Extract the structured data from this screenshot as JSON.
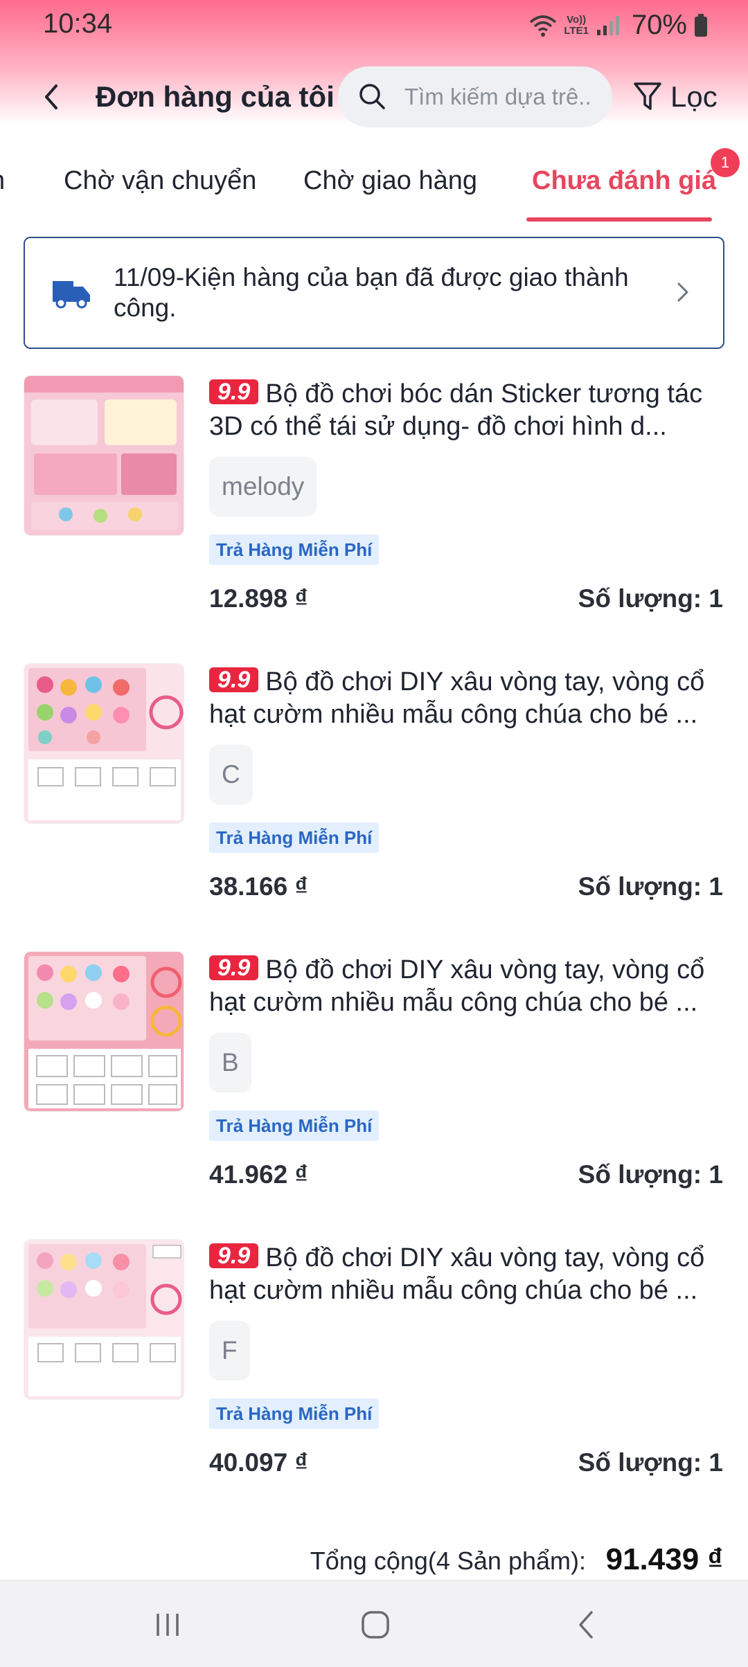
{
  "status_bar": {
    "time": "10:34",
    "network_line1": "Vo))",
    "network_line2": "LTE1",
    "battery": "70%"
  },
  "header": {
    "title": "Đơn hàng của tôi",
    "search_placeholder": "Tìm kiếm dựa trê...",
    "filter_label": "Lọc",
    "accent": "#e8455e"
  },
  "tabs": {
    "items": [
      {
        "label": "n"
      },
      {
        "label": "Chờ vận chuyển"
      },
      {
        "label": "Chờ giao hàng"
      },
      {
        "label": "Chưa đánh giá"
      }
    ],
    "active_index": 3,
    "badge": "1"
  },
  "banner": {
    "text": "11/09-Kiện hàng của bạn đã được giao thành công."
  },
  "orders": [
    {
      "sale_tag": "9.9",
      "title": "Bộ đồ chơi bóc dán Sticker tương tác 3D có thể tái sử dụng- đồ chơi hình d...",
      "variant": "melody",
      "return_badge": "Trả Hàng Miễn Phí",
      "price": "12.898 ₫",
      "quantity": "Số lượng: 1",
      "thumb_bg": "#f7c9d6"
    },
    {
      "sale_tag": "9.9",
      "title": "Bộ đồ chơi DIY xâu vòng tay, vòng cổ hạt cườm nhiều mẫu công chúa cho bé ...",
      "variant": "C",
      "return_badge": "Trả Hàng Miễn Phí",
      "price": "38.166 ₫",
      "quantity": "Số lượng: 1",
      "thumb_bg": "#fbe3ea"
    },
    {
      "sale_tag": "9.9",
      "title": "Bộ đồ chơi DIY xâu vòng tay, vòng cổ hạt cườm nhiều mẫu công chúa cho bé ...",
      "variant": "B",
      "return_badge": "Trả Hàng Miễn Phí",
      "price": "41.962 ₫",
      "quantity": "Số lượng: 1",
      "thumb_bg": "#f4a9b8"
    },
    {
      "sale_tag": "9.9",
      "title": "Bộ đồ chơi DIY xâu vòng tay, vòng cổ hạt cườm nhiều mẫu công chúa cho bé ...",
      "variant": "F",
      "return_badge": "Trả Hàng Miễn Phí",
      "price": "40.097 ₫",
      "quantity": "Số lượng: 1",
      "thumb_bg": "#fbe6ec"
    }
  ],
  "total": {
    "label": "Tổng cộng(4 Sản phẩm):",
    "value": "91.439 ₫"
  },
  "icons": {
    "back": "chevron-left-icon",
    "search": "search-icon",
    "filter": "funnel-icon",
    "truck": "truck-icon",
    "banner_chevron": "chevron-right-icon",
    "nav_recents": "recents-icon",
    "nav_home": "home-icon",
    "nav_back": "back-icon"
  }
}
